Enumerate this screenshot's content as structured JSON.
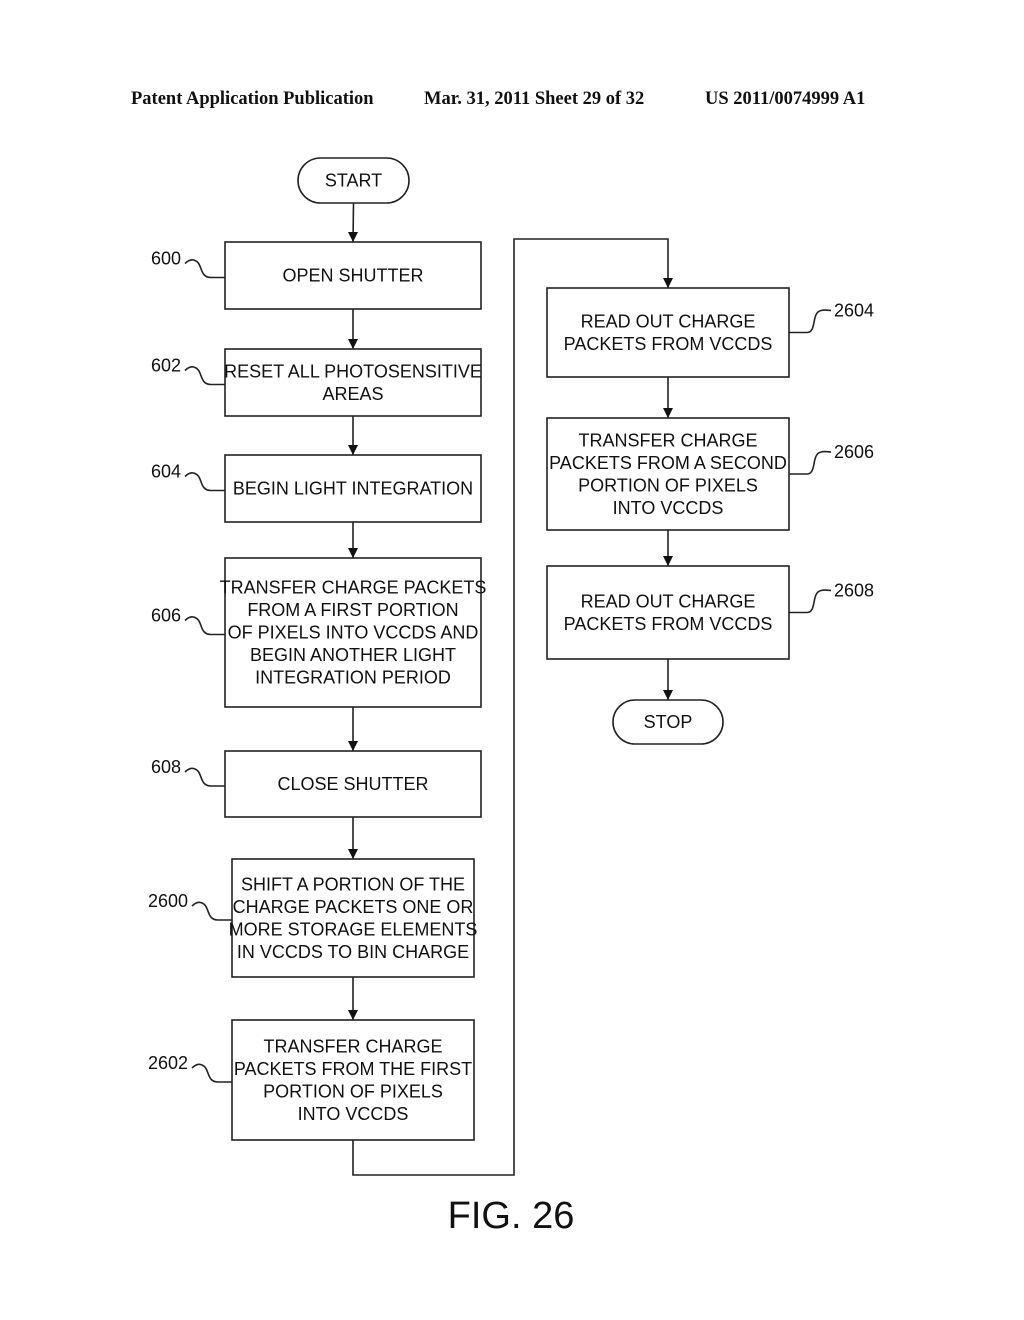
{
  "header": {
    "publication_type": "Patent Application Publication",
    "date_sheet": "Mar. 31, 2011  Sheet 29 of 32",
    "publication_number": "US 2011/0074999 A1"
  },
  "figure": {
    "label": "FIG. 26",
    "nodes": [
      {
        "id": "start",
        "type": "terminal",
        "lines": [
          "START"
        ],
        "ref": ""
      },
      {
        "id": "n600",
        "type": "process",
        "lines": [
          "OPEN SHUTTER"
        ],
        "ref": "600"
      },
      {
        "id": "n602",
        "type": "process",
        "lines": [
          "RESET ALL PHOTOSENSITIVE",
          "AREAS"
        ],
        "ref": "602"
      },
      {
        "id": "n604",
        "type": "process",
        "lines": [
          "BEGIN LIGHT INTEGRATION"
        ],
        "ref": "604"
      },
      {
        "id": "n606",
        "type": "process",
        "lines": [
          "TRANSFER CHARGE PACKETS",
          "FROM A FIRST PORTION",
          "OF PIXELS INTO VCCDS AND",
          "BEGIN ANOTHER LIGHT",
          "INTEGRATION PERIOD"
        ],
        "ref": "606"
      },
      {
        "id": "n608",
        "type": "process",
        "lines": [
          "CLOSE SHUTTER"
        ],
        "ref": "608"
      },
      {
        "id": "n2600",
        "type": "process",
        "lines": [
          "SHIFT A PORTION OF THE",
          "CHARGE PACKETS ONE OR",
          "MORE STORAGE ELEMENTS",
          "IN VCCDS TO BIN CHARGE"
        ],
        "ref": "2600"
      },
      {
        "id": "n2602",
        "type": "process",
        "lines": [
          "TRANSFER CHARGE",
          "PACKETS FROM THE FIRST",
          "PORTION OF PIXELS",
          "INTO VCCDS"
        ],
        "ref": "2602"
      },
      {
        "id": "n2604",
        "type": "process",
        "lines": [
          "READ OUT CHARGE",
          "PACKETS FROM VCCDS"
        ],
        "ref": "2604"
      },
      {
        "id": "n2606",
        "type": "process",
        "lines": [
          "TRANSFER CHARGE",
          "PACKETS FROM A SECOND",
          "PORTION OF PIXELS",
          "INTO VCCDS"
        ],
        "ref": "2606"
      },
      {
        "id": "n2608",
        "type": "process",
        "lines": [
          "READ OUT CHARGE",
          "PACKETS FROM VCCDS"
        ],
        "ref": "2608"
      },
      {
        "id": "stop",
        "type": "terminal",
        "lines": [
          "STOP"
        ],
        "ref": ""
      }
    ],
    "edges": [
      [
        "start",
        "n600"
      ],
      [
        "n600",
        "n602"
      ],
      [
        "n602",
        "n604"
      ],
      [
        "n604",
        "n606"
      ],
      [
        "n606",
        "n608"
      ],
      [
        "n608",
        "n2600"
      ],
      [
        "n2600",
        "n2602"
      ],
      [
        "n2602",
        "n2604"
      ],
      [
        "n2604",
        "n2606"
      ],
      [
        "n2606",
        "n2608"
      ],
      [
        "n2608",
        "stop"
      ]
    ]
  }
}
